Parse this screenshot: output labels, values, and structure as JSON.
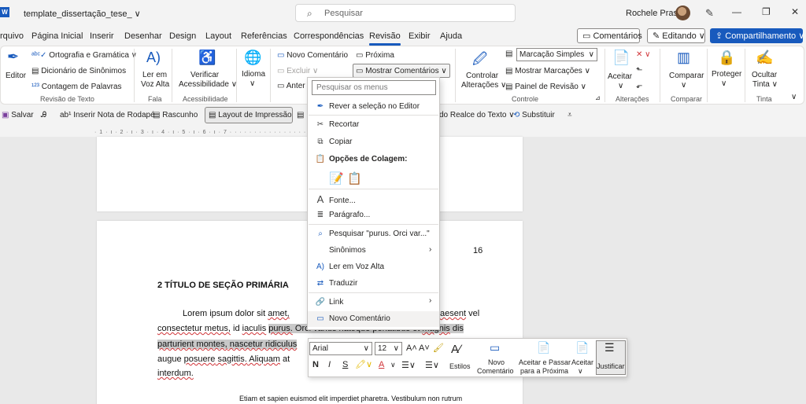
{
  "titlebar": {
    "app_icon": "word-icon",
    "doc_title": "template_dissertação_tese_ ∨",
    "search_placeholder": "Pesquisar",
    "user_name": "Rochele Prass"
  },
  "menubar": {
    "items": [
      "rquivo",
      "Página Inicial",
      "Inserir",
      "Desenhar",
      "Design",
      "Layout",
      "Referências",
      "Correspondências",
      "Revisão",
      "Exibir",
      "Ajuda"
    ],
    "active": "Revisão",
    "comments_btn": "Comentários",
    "editing_btn": "Editando ∨",
    "share_btn": "Compartilhamento ∨"
  },
  "ribbon": {
    "editor": "Editor",
    "spelling": "Ortografia e Gramática ∨",
    "thesaurus": "Dicionário de Sinônimos",
    "wordcount": "Contagem de Palavras",
    "group_review": "Revisão de Texto",
    "read_aloud_1": "Ler em",
    "read_aloud_2": "Voz Alta",
    "group_speech": "Fala",
    "check_1": "Verificar",
    "check_2": "Acessibilidade ∨",
    "group_access": "Acessibilidade",
    "language": "Idioma",
    "language_caret": "∨",
    "new_comment": "Novo Comentário",
    "delete": "Excluir",
    "previous": "Anter",
    "next": "Próxima",
    "show_comments": "Mostrar Comentários",
    "track_1": "Controlar",
    "track_2": "Alterações ∨",
    "markup_select": "Marcação Simples",
    "show_markup": "Mostrar Marcações ∨",
    "review_pane": "Painel de Revisão ∨",
    "group_tracking": "Controle",
    "accept": "Aceitar",
    "group_changes": "Alterações",
    "compare": "Comparar",
    "group_compare": "Comparar",
    "protect": "Proteger",
    "hide_ink_1": "Ocultar",
    "hide_ink_2": "Tinta ∨",
    "group_ink": "Tinta"
  },
  "qat": {
    "save": "Salvar",
    "footnote": "Inserir Nota de Rodapé",
    "draft": "Rascunho",
    "print_layout": "Layout de Impressão",
    "highlight": "do Realce do Texto ∨",
    "replace": "Substituir"
  },
  "ruler": "· 1 · ı · 2 · ı · 3 · ı · 4 · ı · 5 · ı · 6 · ı · 7 · · · · · · · · · · · · · · · · · · · 13 · ı · 14 · ı · 15 · ı · 16 · ı ·",
  "document": {
    "page_number": "16",
    "heading": "2    TÍTULO DE SEÇÃO PRIMÁRIA",
    "line1_a": "Lorem  ipsum  dolor  sit  ",
    "line1_b": "amet,",
    "line1_c": "aesent",
    "line1_d": "  vel",
    "line2_a": "consectetur metus,",
    "line2_b": " id ",
    "line2_c": "iaculis",
    "line2_d": " ",
    "line2_e": "purus.",
    "line2_f": " Orci varius natoque penatibus et ",
    "line2_g": "magnis",
    "line2_h": " dis",
    "line3_a": "parturient montes,",
    "line3_b": " nascetur ridiculus",
    "line4_a": "augue ",
    "line4_b": "posuere",
    "line4_c": " sagittis.",
    "line4_d": " Aliquam",
    "line4_e": " at",
    "line5": "interdum.",
    "quote": "Etiam  et  sapien  euismod  elit  imperdiet  pharetra.  Vestibulum  non  rutrum"
  },
  "context_menu": {
    "search_placeholder": "Pesquisar os menus",
    "items": [
      {
        "icon": "editor-icon",
        "label": "Rever a seleção no Editor"
      },
      {
        "icon": "scissors-icon",
        "label": "Recortar"
      },
      {
        "icon": "copy-icon",
        "label": "Copiar"
      },
      {
        "icon": "paste-icon",
        "label": "Opções de Colagem:"
      },
      {
        "icon": "font-icon",
        "label": "Fonte..."
      },
      {
        "icon": "paragraph-icon",
        "label": "Parágrafo..."
      },
      {
        "icon": "search-icon",
        "label": "Pesquisar \"purus. Orci var...\""
      },
      {
        "icon": "none",
        "label": "Sinônimos"
      },
      {
        "icon": "read-aloud-icon",
        "label": "Ler em Voz Alta"
      },
      {
        "icon": "translate-icon",
        "label": "Traduzir"
      },
      {
        "icon": "link-icon",
        "label": "Link"
      },
      {
        "icon": "comment-icon",
        "label": "Novo Comentário"
      }
    ]
  },
  "mini_toolbar": {
    "font": "Arial",
    "size": "12",
    "styles": "Estilos",
    "new_comment_1": "Novo",
    "new_comment_2": "Comentário",
    "accept_next_1": "Aceitar e Passar",
    "accept_next_2": "para a Próxima",
    "accept": "Aceitar",
    "justify": "Justificar"
  },
  "colors": {
    "accent": "#185abd",
    "squiggle": "#d13438"
  }
}
